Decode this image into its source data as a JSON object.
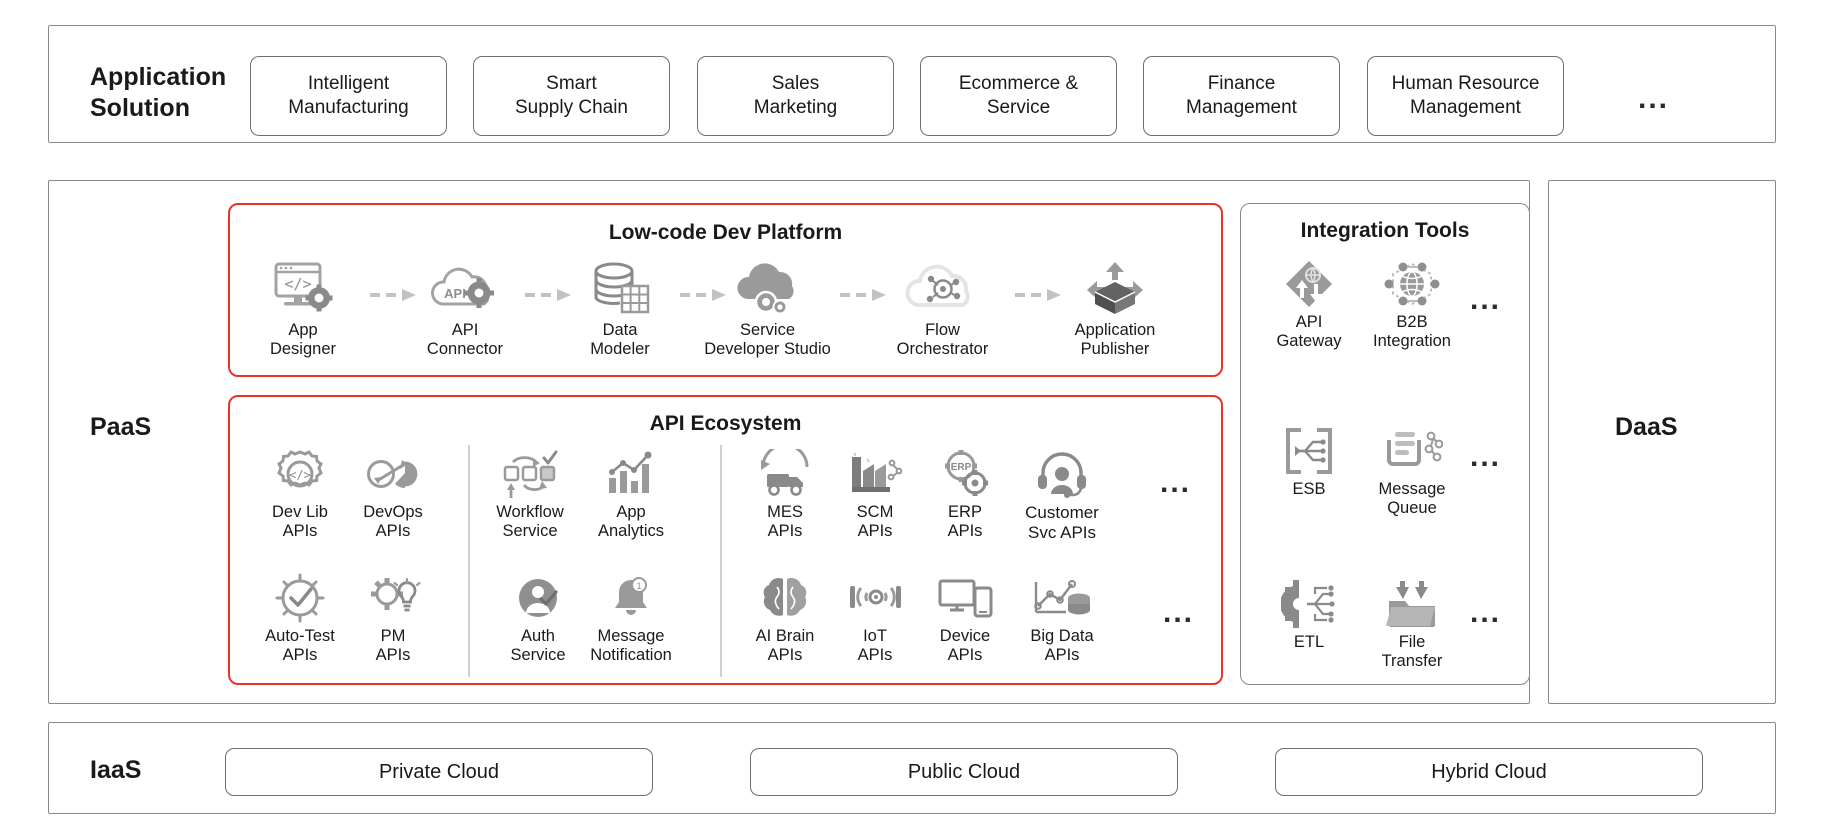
{
  "tiers": {
    "application_solution": {
      "label": "Application\nSolution",
      "cards": [
        "Intelligent\nManufacturing",
        "Smart\nSupply Chain",
        "Sales\nMarketing",
        "Ecommerce &\nService",
        "Finance\nManagement",
        "Human Resource\nManagement"
      ],
      "more": "..."
    },
    "paas": {
      "label": "PaaS"
    },
    "daas": {
      "label": "DaaS"
    },
    "iaas": {
      "label": "IaaS",
      "cards": [
        "Private Cloud",
        "Public Cloud",
        "Hybrid Cloud"
      ]
    }
  },
  "lowcode": {
    "title": "Low-code Dev Platform",
    "nodes": [
      {
        "label": "App\nDesigner",
        "icon": "app-designer-icon"
      },
      {
        "label": "API\nConnector",
        "icon": "api-connector-icon"
      },
      {
        "label": "Data\nModeler",
        "icon": "data-modeler-icon"
      },
      {
        "label": "Service\nDeveloper Studio",
        "icon": "service-developer-studio-icon"
      },
      {
        "label": "Flow\nOrchestrator",
        "icon": "flow-orchestrator-icon"
      },
      {
        "label": "Application\nPublisher",
        "icon": "application-publisher-icon"
      }
    ]
  },
  "api_ecosystem": {
    "title": "API Ecosystem",
    "group1": {
      "row1": [
        {
          "label": "Dev Lib\nAPIs",
          "icon": "dev-lib-gear-code-icon"
        },
        {
          "label": "DevOps\nAPIs",
          "icon": "devops-infinity-icon"
        }
      ],
      "row2": [
        {
          "label": "Auto-Test\nAPIs",
          "icon": "auto-test-check-icon"
        },
        {
          "label": "PM\nAPIs",
          "icon": "pm-gear-bulb-icon"
        }
      ]
    },
    "group2": {
      "row1": [
        {
          "label": "Workflow Service",
          "icon": "workflow-service-icon"
        },
        {
          "label": "App\nAnalytics",
          "icon": "app-analytics-chart-icon"
        }
      ],
      "row2": [
        {
          "label": "Auth\nService",
          "icon": "auth-service-user-icon"
        },
        {
          "label": "Message Notification",
          "icon": "message-notification-bell-icon"
        }
      ]
    },
    "group3": {
      "row1": [
        {
          "label": "MES\nAPIs",
          "icon": "mes-truck-icon"
        },
        {
          "label": "SCM\nAPIs",
          "icon": "scm-factory-icon"
        },
        {
          "label": "ERP\nAPIs",
          "icon": "erp-gear-icon"
        },
        {
          "label": "Customer\nSvc APIs",
          "icon": "customer-service-headset-icon"
        }
      ],
      "row2": [
        {
          "label": "AI Brain\nAPIs",
          "icon": "ai-brain-icon"
        },
        {
          "label": "IoT\nAPIs",
          "icon": "iot-sensor-icon"
        },
        {
          "label": "Device\nAPIs",
          "icon": "device-monitor-icon"
        },
        {
          "label": "Big Data\nAPIs",
          "icon": "big-data-icon"
        }
      ],
      "more_row1": "...",
      "more_row2": "..."
    }
  },
  "integration_tools": {
    "title": "Integration Tools",
    "row1": [
      {
        "label": "API\nGateway",
        "icon": "api-gateway-icon"
      },
      {
        "label": "B2B\nIntegration",
        "icon": "b2b-integration-globe-icon"
      }
    ],
    "row2": [
      {
        "label": "ESB",
        "icon": "esb-icon"
      },
      {
        "label": "Message\nQueue",
        "icon": "message-queue-icon"
      }
    ],
    "row3": [
      {
        "label": "ETL",
        "icon": "etl-gear-icon"
      },
      {
        "label": "File\nTransfer",
        "icon": "file-transfer-icon"
      }
    ],
    "more_row1": "...",
    "more_row2": "...",
    "more_row3": "..."
  },
  "colors": {
    "accent_red": "#e8342a",
    "border_gray": "#8a8a8a",
    "icon_gray": "#9a9a9a",
    "icon_dark": "#6f6f6f",
    "text": "#1a1a1a"
  }
}
